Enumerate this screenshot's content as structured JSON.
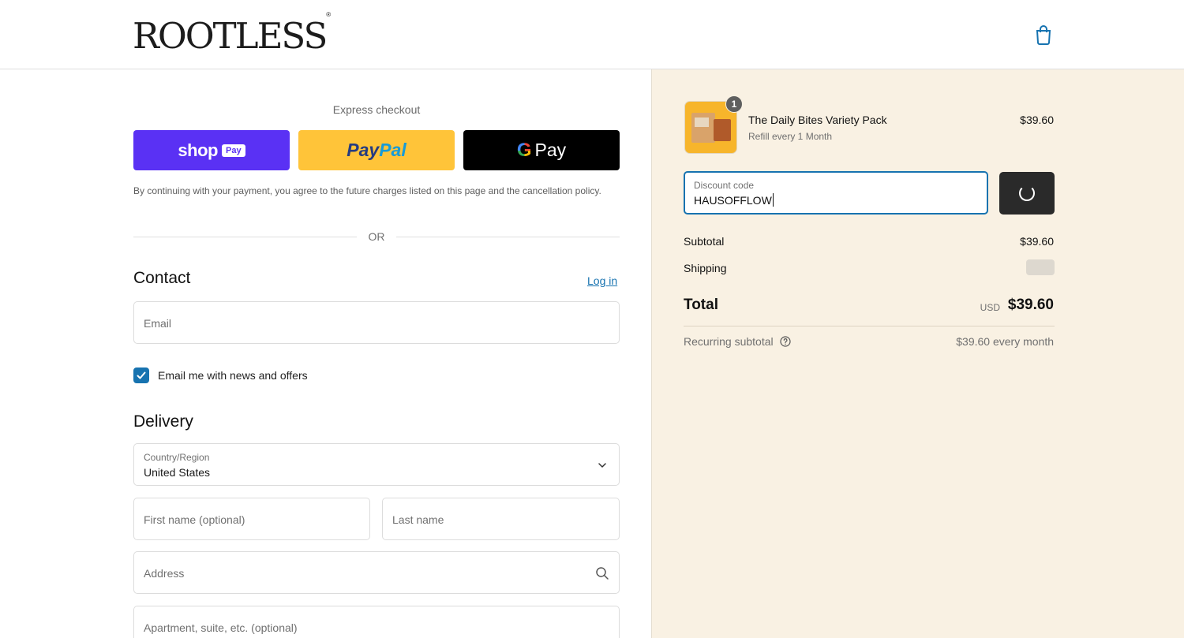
{
  "header": {
    "logo_text": "ROOTLESS",
    "logo_mark": "®",
    "cart_icon": "shopping-bag-icon"
  },
  "express": {
    "title": "Express checkout",
    "shop_pay_label": "shop",
    "shop_pay_badge": "Pay",
    "paypal_label_1": "Pay",
    "paypal_label_2": "Pal",
    "gpay_g": "G",
    "gpay_label": "Pay",
    "terms": "By continuing with your payment, you agree to the future charges listed on this page and the cancellation policy.",
    "or": "OR"
  },
  "contact": {
    "title": "Contact",
    "login": "Log in",
    "email_placeholder": "Email",
    "newsletter_label": "Email me with news and offers",
    "newsletter_checked": true
  },
  "delivery": {
    "title": "Delivery",
    "country_label": "Country/Region",
    "country_value": "United States",
    "first_name_placeholder": "First name (optional)",
    "last_name_placeholder": "Last name",
    "address_placeholder": "Address",
    "apartment_placeholder": "Apartment, suite, etc. (optional)"
  },
  "summary": {
    "product": {
      "quantity": "1",
      "name": "The Daily Bites Variety Pack",
      "subtitle": "Refill every 1 Month",
      "price": "$39.60"
    },
    "discount": {
      "label": "Discount code",
      "value": "HAUSOFFLOW"
    },
    "subtotal_label": "Subtotal",
    "subtotal_value": "$39.60",
    "shipping_label": "Shipping",
    "total_label": "Total",
    "total_currency": "USD",
    "total_value": "$39.60",
    "recurring_label": "Recurring subtotal",
    "recurring_value": "$39.60 every month"
  },
  "colors": {
    "accent": "#1773b0",
    "shop_pay": "#5a31f4",
    "paypal": "#ffc439",
    "summary_bg": "#f9f1e3"
  }
}
